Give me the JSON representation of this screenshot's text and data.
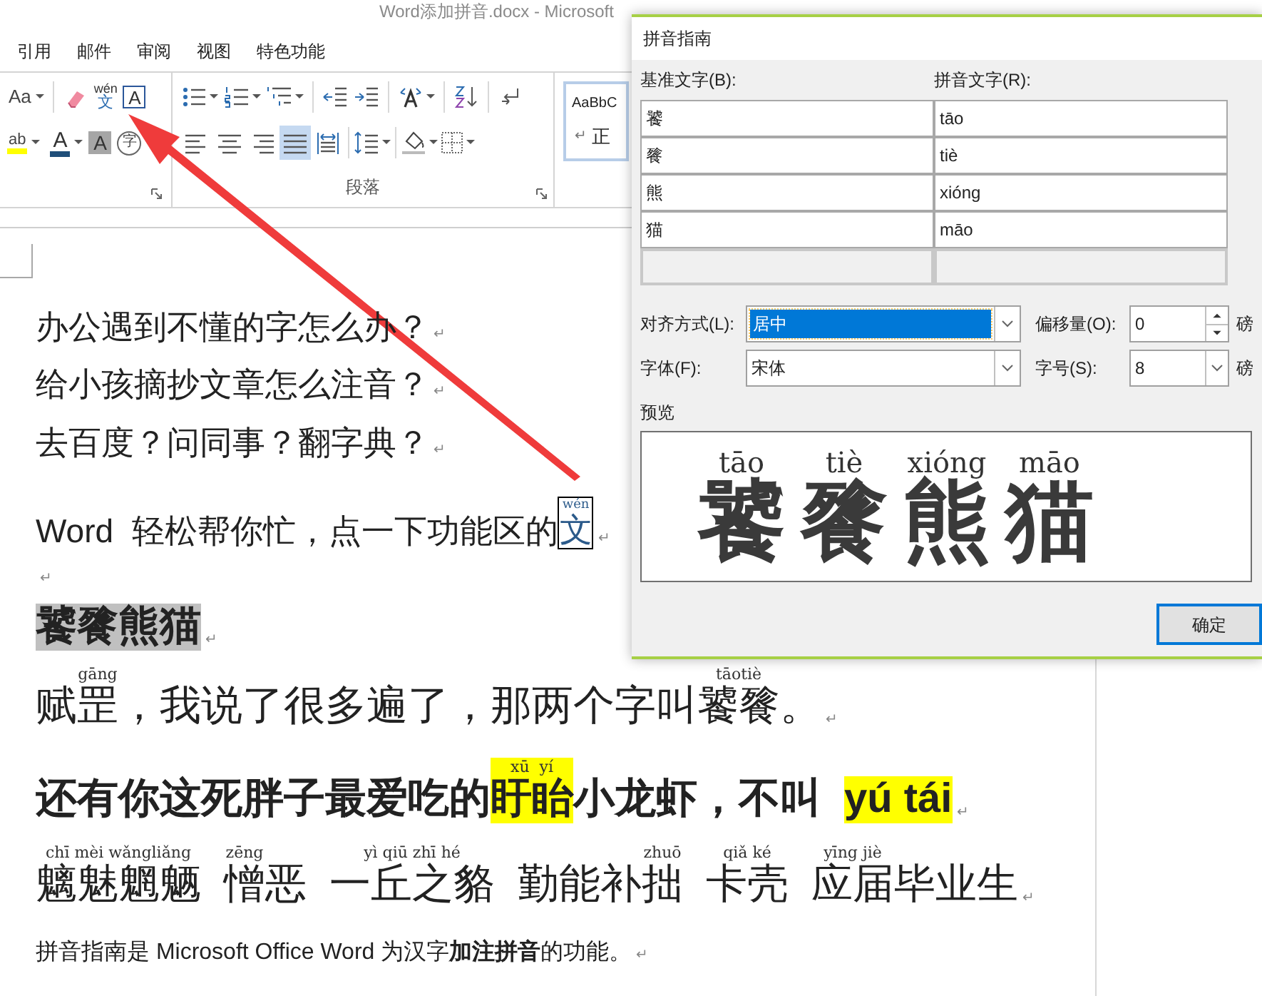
{
  "window": {
    "title": "Word添加拼音.docx - Microsoft"
  },
  "ribbon_tabs": [
    {
      "label": "引用"
    },
    {
      "label": "邮件"
    },
    {
      "label": "审阅"
    },
    {
      "label": "视图"
    },
    {
      "label": "特色功能"
    }
  ],
  "ribbon": {
    "font_size_glyph": "Aa",
    "phonetic_guide": {
      "pinyin": "wén",
      "char": "文"
    },
    "char_border_glyph": "A",
    "highlight_glyph": "ab",
    "font_color_glyph": "A",
    "shading_glyph": "A",
    "enclosed_glyph": "字",
    "align_buttons": [
      {
        "selected": false
      },
      {
        "selected": false
      },
      {
        "selected": false
      },
      {
        "selected": true
      },
      {
        "selected": false
      }
    ],
    "group_label": "段落",
    "style_sample": "AaBbC",
    "style_mark": "↵",
    "style_name": "正"
  },
  "document": {
    "lines": [
      {
        "kind": "body",
        "bold": false,
        "segments": [
          {
            "t": "办公遇到不懂的字怎么办？"
          }
        ],
        "end_mark": "↵"
      },
      {
        "kind": "body",
        "bold": false,
        "segments": [
          {
            "t": "给小孩摘抄文章怎么注音？"
          }
        ],
        "end_mark": "↵"
      },
      {
        "kind": "body",
        "bold": false,
        "segments": [
          {
            "t": "去百度？问同事？翻字典？"
          }
        ],
        "end_mark": "↵"
      },
      {
        "kind": "body",
        "bold": false,
        "segments": [
          {
            "t": "Word  轻松帮你忙，点一下功能区的"
          },
          {
            "t": "文",
            "py": "wén",
            "boxed": true
          }
        ],
        "end_mark": "↵"
      },
      {
        "kind": "body",
        "end_mark": "↵"
      },
      {
        "kind": "large",
        "bold": true,
        "segments": [
          {
            "t": "饕餮熊猫",
            "color": "#c0c0c0"
          }
        ],
        "end_mark": "↵"
      },
      {
        "kind": "large",
        "bold": false,
        "segments": [
          {
            "t": "赋"
          },
          {
            "t": "罡",
            "py": "gāng"
          },
          {
            "t": "，我说了很多遍了，那两个字叫"
          },
          {
            "t": "饕餮",
            "py": "tāotiè"
          },
          {
            "t": "。"
          }
        ],
        "end_mark": "↵"
      },
      {
        "kind": "large",
        "bold": true,
        "segments": [
          {
            "t": "还有你这死胖子最爱吃的"
          },
          {
            "t": "盱眙",
            "py": "xū  yí",
            "color": "#ffff00"
          },
          {
            "t": "小龙虾，不叫"
          },
          {
            "t": "yú tái",
            "color": "#ffff00",
            "gap_before": true
          }
        ],
        "end_mark": "↵"
      },
      {
        "kind": "large",
        "bold": false,
        "segments": [
          {
            "t": "魑魅魍魉",
            "py": "chī mèi wǎngliǎng"
          },
          {
            "t": "憎",
            "py": "zēng",
            "gap_before": true
          },
          {
            "t": "恶"
          },
          {
            "t": "一丘之貉",
            "py": "yì qiū zhī hé",
            "gap_before": true
          },
          {
            "t": "勤能补",
            "gap_before": true
          },
          {
            "t": "拙",
            "py": "zhuō"
          },
          {
            "t": "卡壳",
            "py": "qiǎ ké",
            "gap_before": true
          },
          {
            "t": "应届",
            "py": "yīng jiè",
            "gap_before": true
          },
          {
            "t": "毕业生"
          }
        ],
        "end_mark": "↵"
      },
      {
        "kind": "note",
        "bold": false,
        "segments": [
          {
            "t": "拼音指南是 Microsoft Office Word 为汉字**加注拼音**的功能。"
          }
        ],
        "end_mark": "↵"
      }
    ]
  },
  "dialog": {
    "title": "拼音指南",
    "base_label": "基准文字(B):",
    "ruby_label": "拼音文字(R):",
    "rows": [
      {
        "base": "饕",
        "ruby": "tāo"
      },
      {
        "base": "餮",
        "ruby": "tiè"
      },
      {
        "base": "熊",
        "ruby": "xióng"
      },
      {
        "base": "猫",
        "ruby": "māo"
      }
    ],
    "alignment": {
      "label": "对齐方式(L):",
      "value": "居中",
      "focused": true
    },
    "offset": {
      "label": "偏移量(O):",
      "value": "0",
      "unit": "磅"
    },
    "font": {
      "label": "字体(F):",
      "value": "宋体"
    },
    "size": {
      "label": "字号(S):",
      "value": "8",
      "unit": "磅"
    },
    "preview_label": "预览",
    "preview": [
      {
        "base": "饕",
        "ruby": "tāo"
      },
      {
        "base": "餮",
        "ruby": "tiè"
      },
      {
        "base": "熊",
        "ruby": "xióng"
      },
      {
        "base": "猫",
        "ruby": "māo"
      }
    ],
    "ok_button": "确定"
  }
}
